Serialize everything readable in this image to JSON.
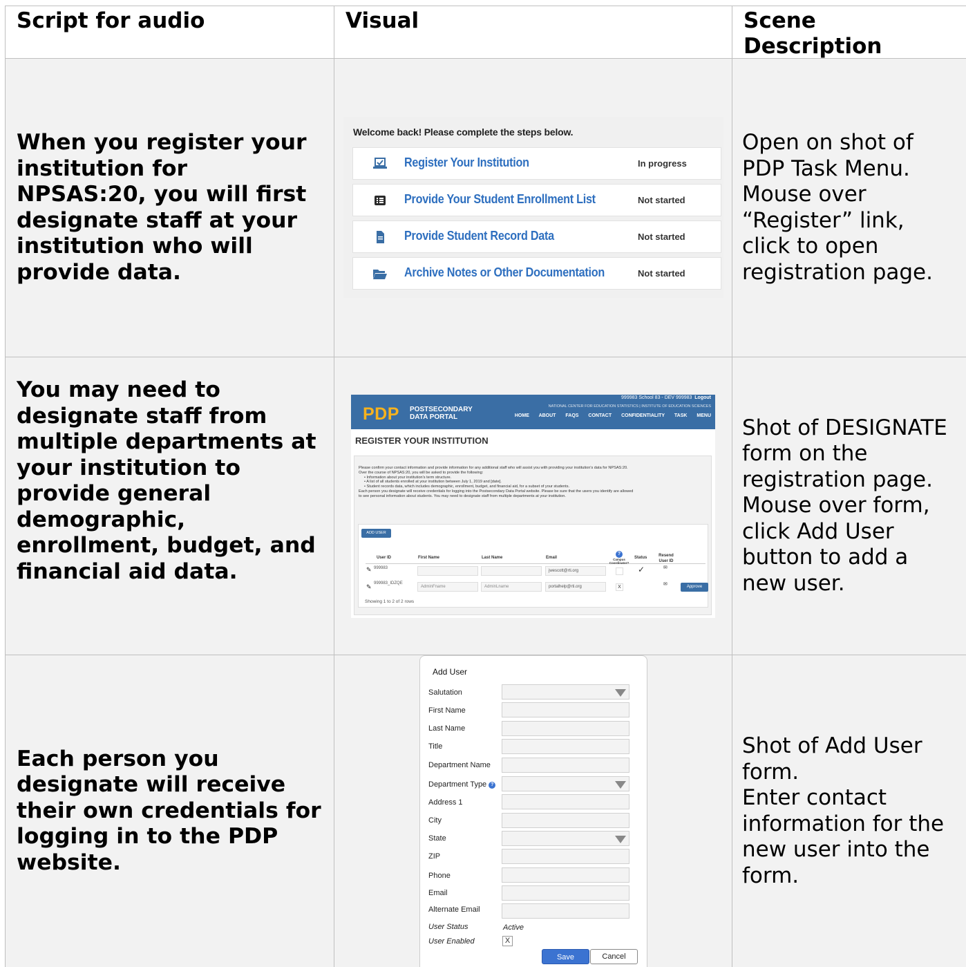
{
  "headers": [
    "Script for audio",
    "Visual",
    "Scene Description"
  ],
  "rows": [
    {
      "script": "When you register your institution for NPSAS:20, you will first designate staff at your institution who will provide data.",
      "scene": "Open on shot of PDP Task Menu. Mouse over “Register” link, click to open registration page."
    },
    {
      "script": "You may need to designate staff from multiple departments at your institution to provide general demographic, enrollment, budget, and financial aid data.",
      "scene": "Shot of DESIGNATE form on the registration page. Mouse over form, click Add User button to add a new user."
    },
    {
      "script": "Each person you designate will receive their own credentials for logging in to the PDP website.",
      "scene_lines": [
        "Shot of Add User form.",
        "Enter contact information for the new user into the form."
      ]
    }
  ],
  "task_menu": {
    "title": "Welcome back! Please complete the steps below.",
    "items": [
      {
        "label": "Register Your Institution",
        "status": "In progress",
        "icon": "laptop-check-icon"
      },
      {
        "label": "Provide Your Student Enrollment List",
        "status": "Not started",
        "icon": "list-icon"
      },
      {
        "label": "Provide Student Record Data",
        "status": "Not started",
        "icon": "document-icon"
      },
      {
        "label": "Archive Notes or Other Documentation",
        "status": "Not started",
        "icon": "folder-open-icon"
      }
    ]
  },
  "registration": {
    "user_line": "999983 School 83 - DEV 999983",
    "logout": "Logout",
    "nces": "NATIONAL CENTER FOR EDUCATION STATISTICS | INSTITUTE OF EDUCATION SCIENCES",
    "logo": "PDP",
    "logo_line1": "POSTSECONDARY",
    "logo_line2": "DATA PORTAL",
    "nav": [
      "HOME",
      "ABOUT",
      "FAQS",
      "CONTACT",
      "CONFIDENTIALITY",
      "TASK MENU"
    ],
    "heading": "REGISTER YOUR INSTITUTION",
    "intro": [
      "Please confirm your contact information and provide information for any additional staff who will assist you with providing your institution's data for NPSAS:20.",
      "Over the course of NPSAS:20, you will be asked to provide the following:",
      "• Information about your institution's term structure.",
      "• A list of all students enrolled at your institution between July 1, 2019 and [date].",
      "• Student records data, which includes demographic, enrollment, budget, and financial aid, for a subset of your students.",
      "Each person you designate will receive credentials for logging into the Postsecondary Data Portal website. Please be sure that the users you identify are allowed",
      "to see personal information about students. You may need to designate staff from multiple departments at your institution."
    ],
    "add_user": "ADD USER",
    "columns": [
      "User ID",
      "First Name",
      "Last Name",
      "Email",
      "Campus Coordinator?",
      "Status",
      "Resend User ID"
    ],
    "rows": [
      {
        "user_id": "999983",
        "first": "",
        "last": "",
        "email": "jwescott@rti.org",
        "coordinator": "",
        "status": "✓",
        "resend": "✉"
      },
      {
        "user_id": "999983_IDZQE",
        "first": "AdminFname",
        "last": "AdminLname",
        "email": "portalhelp@rti.org",
        "coordinator": "X",
        "status": "",
        "resend": "✉"
      }
    ],
    "approve": "Approve",
    "showing": "Showing 1 to 2 of 2 rows"
  },
  "add_user_form": {
    "title": "Add User",
    "fields": [
      {
        "label": "Salutation",
        "dropdown": true
      },
      {
        "label": "First Name",
        "dropdown": false
      },
      {
        "label": "Last Name",
        "dropdown": false
      },
      {
        "label": "Title",
        "dropdown": false
      },
      {
        "label": "Department Name",
        "dropdown": false
      },
      {
        "label": "Department Type",
        "dropdown": true
      },
      {
        "label": "Address 1",
        "dropdown": false
      },
      {
        "label": "City",
        "dropdown": false
      },
      {
        "label": "State",
        "dropdown": true
      },
      {
        "label": "ZIP",
        "dropdown": false
      },
      {
        "label": "Phone",
        "dropdown": false
      },
      {
        "label": "Email",
        "dropdown": false
      },
      {
        "label": "Alternate Email",
        "dropdown": false
      }
    ],
    "user_status_label": "User Status",
    "user_status_value": "Active",
    "user_enabled_label": "User Enabled",
    "user_enabled_value": "X",
    "save": "Save",
    "cancel": "Cancel"
  },
  "colors": {
    "cell_bg": "#f2f2f2",
    "link_blue": "#2e6fbf",
    "banner_blue": "#3a6ea5",
    "logo_gold": "#f6b21e"
  }
}
